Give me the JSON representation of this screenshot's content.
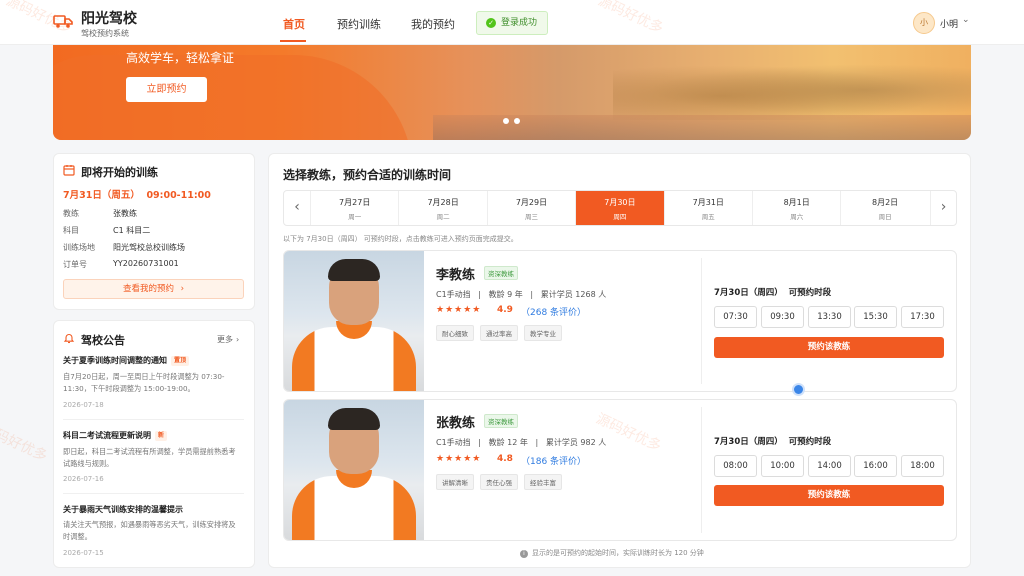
{
  "header": {
    "brand_title": "阳光驾校",
    "brand_sub": "驾校预约系统",
    "nav": [
      "首页",
      "预约训练",
      "我的预约"
    ],
    "toast": "登录成功",
    "avatar_char": "小",
    "username": "小明"
  },
  "banner": {
    "slogan": "高效学车，轻松拿证",
    "cta": "立即预约"
  },
  "upcoming": {
    "title": "即将开始的训练",
    "datetime": "7月31日（周五）  09:00-11:00",
    "rows": [
      {
        "k": "教练",
        "v": "张教练"
      },
      {
        "k": "科目",
        "v": "C1 科目二"
      },
      {
        "k": "训练场地",
        "v": "阳光驾校总校训练场"
      },
      {
        "k": "订单号",
        "v": "YY20260731001"
      }
    ],
    "button": "查看我的预约"
  },
  "announcements": {
    "title": "驾校公告",
    "more": "更多",
    "items": [
      {
        "title": "关于夏季训练时间调整的通知",
        "badge": "置顶",
        "body": "自7月20日起，周一至周日上午时段调整为 07:30-11:30，下午时段调整为 15:00-19:00。",
        "date": "2026-07-18"
      },
      {
        "title": "科目二考试流程更新说明",
        "badge": "新",
        "body": "即日起，科目二考试流程有所调整，学员需提前熟悉考试路线与规则。",
        "date": "2026-07-16"
      },
      {
        "title": "关于暴雨天气训练安排的温馨提示",
        "badge": "",
        "body": "请关注天气预报，如遇暴雨等恶劣天气，训练安排将及时调整。",
        "date": "2026-07-15"
      }
    ]
  },
  "booking": {
    "title": "选择教练，预约合适的训练时间",
    "dates": [
      {
        "d": "7月27日",
        "w": "周一"
      },
      {
        "d": "7月28日",
        "w": "周二"
      },
      {
        "d": "7月29日",
        "w": "周三"
      },
      {
        "d": "7月30日",
        "w": "周四"
      },
      {
        "d": "7月31日",
        "w": "周五"
      },
      {
        "d": "8月1日",
        "w": "周六"
      },
      {
        "d": "8月2日",
        "w": "周日"
      }
    ],
    "selected_index": 3,
    "hint": "以下为 7月30日（周四） 可预约时段，点击教练可进入预约页面完成提交。",
    "footer_note": "显示的是可预约的起始时间，实际训练时长为 120 分钟"
  },
  "coaches": [
    {
      "name": "李教练",
      "tag": "资深教练",
      "meta": "C1手动挡   |   教龄 9 年   |   累计学员 1268 人",
      "stars": "★★★★★",
      "score": "4.9",
      "reviews": "（268 条评价）",
      "chips": [
        "耐心细致",
        "通过率高",
        "教学专业"
      ],
      "slot_title": "7月30日（周四）  可预约时段",
      "slots": [
        "07:30",
        "09:30",
        "13:30",
        "15:30",
        "17:30"
      ],
      "book": "预约该教练"
    },
    {
      "name": "张教练",
      "tag": "资深教练",
      "meta": "C1手动挡   |   教龄 12 年   |   累计学员 982 人",
      "stars": "★★★★★",
      "score": "4.8",
      "reviews": "（186 条评价）",
      "chips": [
        "讲解清晰",
        "责任心强",
        "经验丰富"
      ],
      "slot_title": "7月30日（周四）  可预约时段",
      "slots": [
        "08:00",
        "10:00",
        "14:00",
        "16:00",
        "18:00"
      ],
      "book": "预约该教练"
    }
  ],
  "watermark": "源码好优多",
  "colors": {
    "accent": "#f15a22",
    "success": "#52c41a",
    "link": "#2f7be0"
  }
}
